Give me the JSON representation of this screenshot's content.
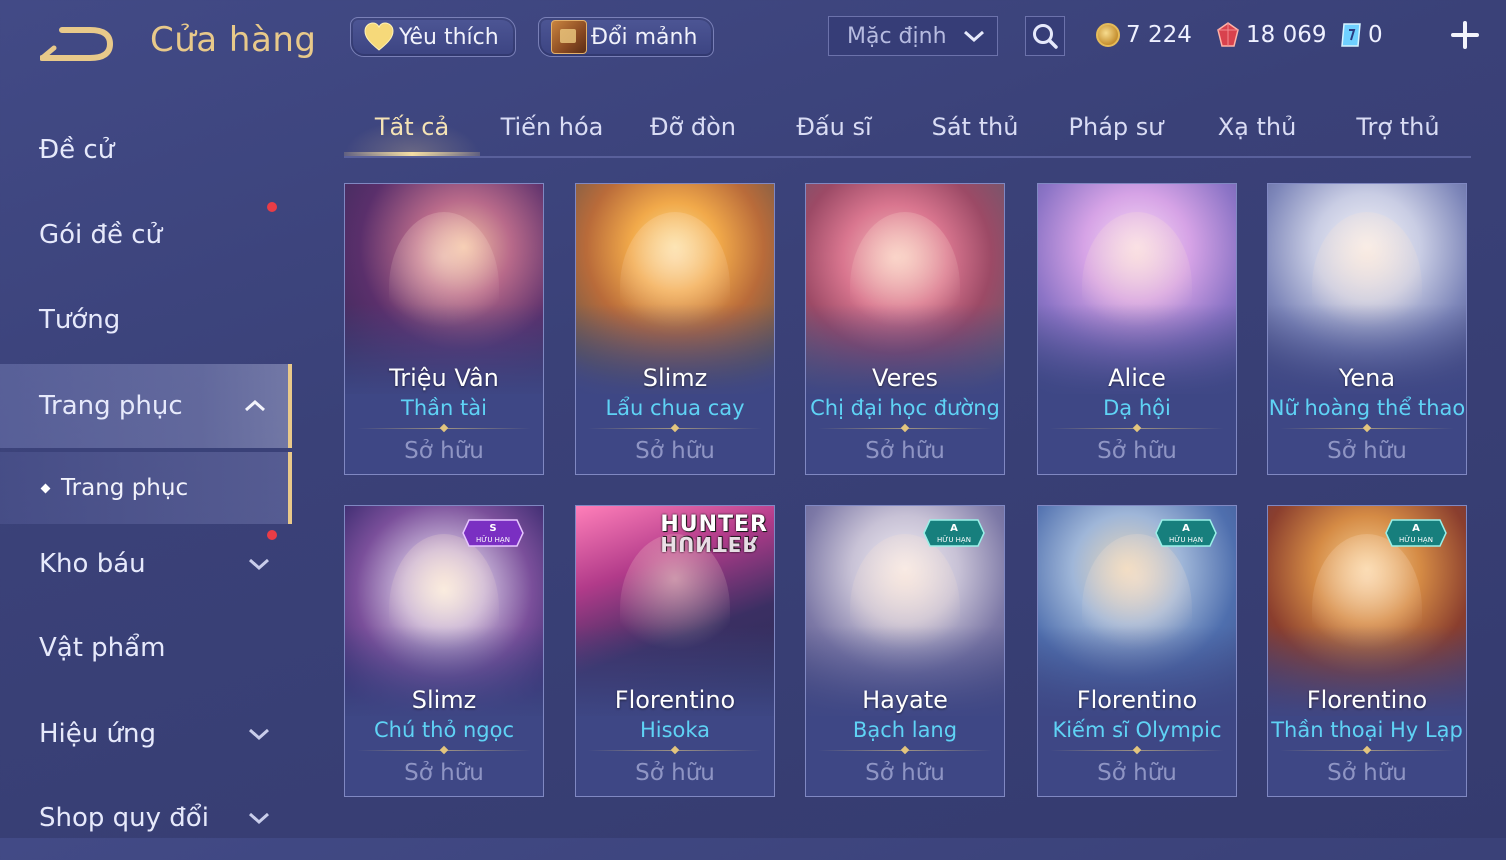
{
  "header": {
    "title": "Cửa hàng",
    "favorites_label": "Yêu thích",
    "exchange_label": "Đổi mảnh",
    "sort": {
      "selected": "Mặc định"
    },
    "currencies": [
      {
        "name": "gold",
        "amount": "7 224"
      },
      {
        "name": "ruby",
        "amount": "18 069"
      },
      {
        "name": "voucher",
        "amount": "0"
      }
    ]
  },
  "sidebar": {
    "items": [
      {
        "label": "Đề cử"
      },
      {
        "label": "Gói đề cử"
      },
      {
        "label": "Tướng"
      },
      {
        "label": "Trang phục"
      },
      {
        "label": "Trang phục"
      },
      {
        "label": "Kho báu"
      },
      {
        "label": "Vật phẩm"
      },
      {
        "label": "Hiệu ứng"
      },
      {
        "label": "Shop quy đổi"
      }
    ]
  },
  "tabs": [
    {
      "label": "Tất cả"
    },
    {
      "label": "Tiến hóa"
    },
    {
      "label": "Đỡ đòn"
    },
    {
      "label": "Đấu sĩ"
    },
    {
      "label": "Sát thủ"
    },
    {
      "label": "Pháp sư"
    },
    {
      "label": "Xạ thủ"
    },
    {
      "label": "Trợ thủ"
    }
  ],
  "cards": [
    {
      "hero": "Triệu Vân",
      "skin": "Thần tài",
      "status": "Sở hữu"
    },
    {
      "hero": "Slimz",
      "skin": "Lẩu chua cay",
      "status": "Sở hữu"
    },
    {
      "hero": "Veres",
      "skin": "Chị đại học đường",
      "status": "Sở hữu"
    },
    {
      "hero": "Alice",
      "skin": "Dạ hội",
      "status": "Sở hữu"
    },
    {
      "hero": "Yena",
      "skin": "Nữ hoàng thể thao",
      "status": "Sở hữu"
    },
    {
      "hero": "Slimz",
      "skin": "Chú thỏ ngọc",
      "status": "Sở hữu",
      "badge": {
        "tier": "S",
        "text": "HỮU HẠN"
      }
    },
    {
      "hero": "Florentino",
      "skin": "Hisoka",
      "status": "Sở hữu",
      "logo": "HUNTER"
    },
    {
      "hero": "Hayate",
      "skin": "Bạch lang",
      "status": "Sở hữu",
      "badge": {
        "tier": "A",
        "text": "HỮU HẠN"
      }
    },
    {
      "hero": "Florentino",
      "skin": "Kiếm sĩ Olympic",
      "status": "Sở hữu",
      "badge": {
        "tier": "A",
        "text": "HỮU HẠN"
      }
    },
    {
      "hero": "Florentino",
      "skin": "Thần thoại Hy Lạp",
      "status": "Sở hữu",
      "badge": {
        "tier": "A",
        "text": "HỮU HẠN"
      }
    }
  ],
  "colors": {
    "accent_gold": "#e8c98a",
    "skin_name_cyan": "#5fd3f5",
    "notification_red": "#ea3c46"
  }
}
